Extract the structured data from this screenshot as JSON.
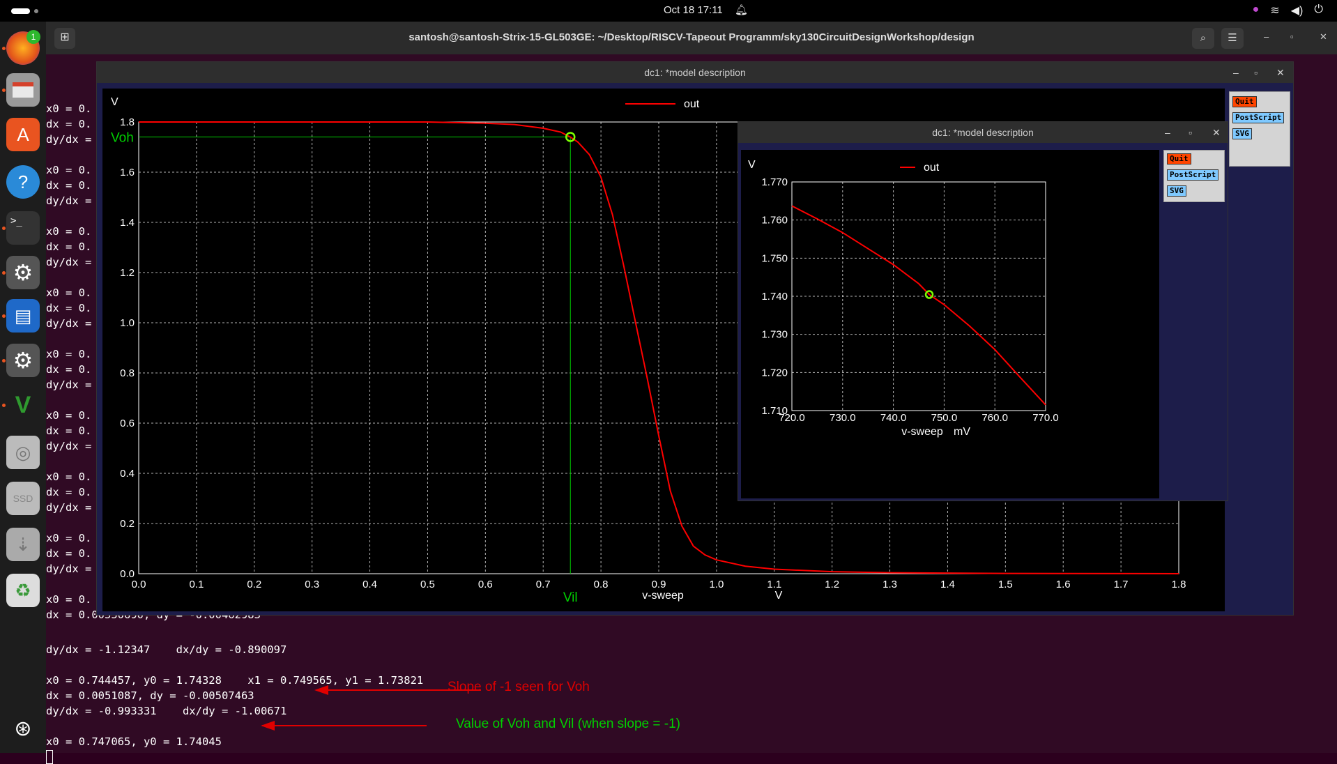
{
  "topbar": {
    "clock": "Oct 18  17:11",
    "bell_icon": "bell-icon",
    "tray_icons": [
      "app-icon",
      "wifi-icon",
      "volume-icon",
      "power-icon"
    ]
  },
  "dock": {
    "badge": "1",
    "apps": [
      "firefox-icon",
      "files-icon",
      "app-center-icon",
      "help-icon",
      "terminal-icon",
      "settings-icon",
      "writer-icon",
      "software-updater-icon",
      "vim-icon",
      "disc-icon",
      "ssd-icon",
      "usb-icon",
      "trash-icon",
      "show-apps-icon"
    ]
  },
  "terminal": {
    "title": "santosh@santosh-Strix-15-GL503GE: ~/Desktop/RISCV-Tapeout Programm/sky130CircuitDesignWorkshop/design",
    "left_lines": [
      "x0 = 0.",
      "dx = 0.",
      "dy/dx =",
      "",
      "x0 = 0.",
      "dx = 0.",
      "dy/dx =",
      "",
      "x0 = 0.",
      "dx = 0.",
      "dy/dx =",
      "",
      "x0 = 0.",
      "dx = 0.",
      "dy/dx =",
      "",
      "x0 = 0.",
      "dx = 0.",
      "dy/dx =",
      "",
      "x0 = 0.",
      "dx = 0.",
      "dy/dx =",
      "",
      "x0 = 0.",
      "dx = 0.",
      "dy/dx =",
      "",
      "x0 = 0.",
      "dx = 0.",
      "dy/dx =",
      "",
      "x0 = 0.",
      "dx = 0.00550690, dy = -0.00462983"
    ],
    "lines": [
      "dy/dx = -1.12347    dx/dy = -0.890097",
      "",
      "x0 = 0.744457, y0 = 1.74328    x1 = 0.749565, y1 = 1.73821",
      "dx = 0.0051087, dy = -0.00507463",
      "dy/dx = -0.993331    dx/dy = -1.00671",
      "",
      "x0 = 0.747065, y0 = 1.74045"
    ],
    "annotation1": "Slope of -1 seen for Voh",
    "annotation2": "Value of Voh and Vil (when slope = -1)",
    "annotation1_color": "#e00000",
    "annotation2_color": "#00d000"
  },
  "main_window": {
    "title": "dc1: *model description",
    "buttons": {
      "quit": "Quit",
      "postscript": "PostScript",
      "svg": "SVG"
    }
  },
  "zoom_window": {
    "title": "dc1: *model description",
    "buttons": {
      "quit": "Quit",
      "postscript": "PostScript",
      "svg": "SVG"
    }
  },
  "chart_data": [
    {
      "type": "line",
      "ylabel": "V",
      "xlabel": "v-sweep",
      "xunit": "V",
      "legend": "out",
      "legend_placement": "top-center",
      "xlim": [
        0.0,
        1.8
      ],
      "ylim": [
        0.0,
        1.8
      ],
      "x_ticks": [
        "0.0",
        "0.1",
        "0.2",
        "0.3",
        "0.4",
        "0.5",
        "0.6",
        "0.7",
        "0.8",
        "0.9",
        "1.0",
        "1.1",
        "1.2",
        "1.3",
        "1.4",
        "1.5",
        "1.6",
        "1.7",
        "1.8"
      ],
      "y_ticks": [
        "0.0",
        "0.2",
        "0.4",
        "0.6",
        "0.8",
        "1.0",
        "1.2",
        "1.4",
        "1.6",
        "1.8"
      ],
      "grid": true,
      "series": [
        {
          "name": "out",
          "color": "#ff0000",
          "x": [
            0.0,
            0.3,
            0.5,
            0.6,
            0.65,
            0.7,
            0.73,
            0.747,
            0.76,
            0.78,
            0.8,
            0.82,
            0.84,
            0.86,
            0.88,
            0.9,
            0.92,
            0.94,
            0.96,
            0.98,
            1.0,
            1.05,
            1.1,
            1.2,
            1.3,
            1.5,
            1.8
          ],
          "y": [
            1.8,
            1.8,
            1.8,
            1.795,
            1.79,
            1.775,
            1.76,
            1.74,
            1.72,
            1.67,
            1.58,
            1.43,
            1.22,
            1.0,
            0.78,
            0.55,
            0.33,
            0.19,
            0.11,
            0.075,
            0.055,
            0.03,
            0.018,
            0.008,
            0.004,
            0.001,
            0.0
          ]
        }
      ],
      "markers": [
        {
          "label": "Voh",
          "y": 1.74045,
          "color": "#00d000"
        },
        {
          "label": "Vil",
          "x": 0.747065,
          "color": "#00d000"
        }
      ],
      "point": {
        "x": 0.747065,
        "y": 1.74045
      }
    },
    {
      "type": "line",
      "ylabel": "V",
      "xlabel": "v-sweep",
      "xunit": "mV",
      "legend": "out",
      "xlim": [
        720.0,
        770.0
      ],
      "ylim": [
        1.71,
        1.77
      ],
      "x_ticks": [
        "720.0",
        "730.0",
        "740.0",
        "750.0",
        "760.0",
        "770.0"
      ],
      "y_ticks": [
        "1.710",
        "1.720",
        "1.730",
        "1.740",
        "1.750",
        "1.760",
        "1.770"
      ],
      "grid": true,
      "series": [
        {
          "name": "out",
          "color": "#ff0000",
          "x": [
            720.0,
            725.0,
            730.0,
            735.0,
            740.0,
            745.0,
            747.065,
            750.0,
            755.0,
            760.0,
            765.0,
            770.0
          ],
          "y": [
            1.7637,
            1.7603,
            1.7567,
            1.7525,
            1.7483,
            1.7433,
            1.74045,
            1.7378,
            1.7322,
            1.726,
            1.7187,
            1.7115
          ]
        }
      ],
      "point": {
        "x": 747.065,
        "y": 1.74045
      }
    }
  ]
}
